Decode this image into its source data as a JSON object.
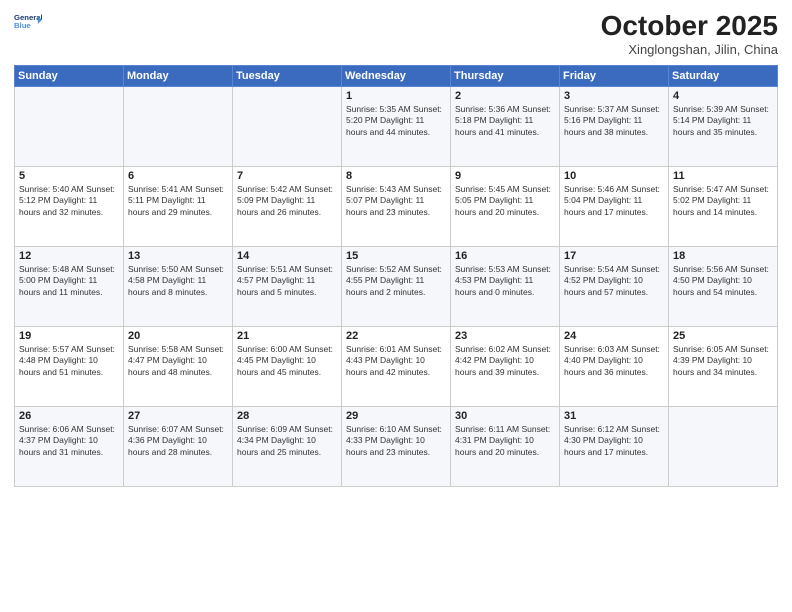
{
  "header": {
    "logo_line1": "General",
    "logo_line2": "Blue",
    "month": "October 2025",
    "location": "Xinglongshan, Jilin, China"
  },
  "weekdays": [
    "Sunday",
    "Monday",
    "Tuesday",
    "Wednesday",
    "Thursday",
    "Friday",
    "Saturday"
  ],
  "weeks": [
    [
      {
        "day": "",
        "info": ""
      },
      {
        "day": "",
        "info": ""
      },
      {
        "day": "",
        "info": ""
      },
      {
        "day": "1",
        "info": "Sunrise: 5:35 AM\nSunset: 5:20 PM\nDaylight: 11 hours\nand 44 minutes."
      },
      {
        "day": "2",
        "info": "Sunrise: 5:36 AM\nSunset: 5:18 PM\nDaylight: 11 hours\nand 41 minutes."
      },
      {
        "day": "3",
        "info": "Sunrise: 5:37 AM\nSunset: 5:16 PM\nDaylight: 11 hours\nand 38 minutes."
      },
      {
        "day": "4",
        "info": "Sunrise: 5:39 AM\nSunset: 5:14 PM\nDaylight: 11 hours\nand 35 minutes."
      }
    ],
    [
      {
        "day": "5",
        "info": "Sunrise: 5:40 AM\nSunset: 5:12 PM\nDaylight: 11 hours\nand 32 minutes."
      },
      {
        "day": "6",
        "info": "Sunrise: 5:41 AM\nSunset: 5:11 PM\nDaylight: 11 hours\nand 29 minutes."
      },
      {
        "day": "7",
        "info": "Sunrise: 5:42 AM\nSunset: 5:09 PM\nDaylight: 11 hours\nand 26 minutes."
      },
      {
        "day": "8",
        "info": "Sunrise: 5:43 AM\nSunset: 5:07 PM\nDaylight: 11 hours\nand 23 minutes."
      },
      {
        "day": "9",
        "info": "Sunrise: 5:45 AM\nSunset: 5:05 PM\nDaylight: 11 hours\nand 20 minutes."
      },
      {
        "day": "10",
        "info": "Sunrise: 5:46 AM\nSunset: 5:04 PM\nDaylight: 11 hours\nand 17 minutes."
      },
      {
        "day": "11",
        "info": "Sunrise: 5:47 AM\nSunset: 5:02 PM\nDaylight: 11 hours\nand 14 minutes."
      }
    ],
    [
      {
        "day": "12",
        "info": "Sunrise: 5:48 AM\nSunset: 5:00 PM\nDaylight: 11 hours\nand 11 minutes."
      },
      {
        "day": "13",
        "info": "Sunrise: 5:50 AM\nSunset: 4:58 PM\nDaylight: 11 hours\nand 8 minutes."
      },
      {
        "day": "14",
        "info": "Sunrise: 5:51 AM\nSunset: 4:57 PM\nDaylight: 11 hours\nand 5 minutes."
      },
      {
        "day": "15",
        "info": "Sunrise: 5:52 AM\nSunset: 4:55 PM\nDaylight: 11 hours\nand 2 minutes."
      },
      {
        "day": "16",
        "info": "Sunrise: 5:53 AM\nSunset: 4:53 PM\nDaylight: 11 hours\nand 0 minutes."
      },
      {
        "day": "17",
        "info": "Sunrise: 5:54 AM\nSunset: 4:52 PM\nDaylight: 10 hours\nand 57 minutes."
      },
      {
        "day": "18",
        "info": "Sunrise: 5:56 AM\nSunset: 4:50 PM\nDaylight: 10 hours\nand 54 minutes."
      }
    ],
    [
      {
        "day": "19",
        "info": "Sunrise: 5:57 AM\nSunset: 4:48 PM\nDaylight: 10 hours\nand 51 minutes."
      },
      {
        "day": "20",
        "info": "Sunrise: 5:58 AM\nSunset: 4:47 PM\nDaylight: 10 hours\nand 48 minutes."
      },
      {
        "day": "21",
        "info": "Sunrise: 6:00 AM\nSunset: 4:45 PM\nDaylight: 10 hours\nand 45 minutes."
      },
      {
        "day": "22",
        "info": "Sunrise: 6:01 AM\nSunset: 4:43 PM\nDaylight: 10 hours\nand 42 minutes."
      },
      {
        "day": "23",
        "info": "Sunrise: 6:02 AM\nSunset: 4:42 PM\nDaylight: 10 hours\nand 39 minutes."
      },
      {
        "day": "24",
        "info": "Sunrise: 6:03 AM\nSunset: 4:40 PM\nDaylight: 10 hours\nand 36 minutes."
      },
      {
        "day": "25",
        "info": "Sunrise: 6:05 AM\nSunset: 4:39 PM\nDaylight: 10 hours\nand 34 minutes."
      }
    ],
    [
      {
        "day": "26",
        "info": "Sunrise: 6:06 AM\nSunset: 4:37 PM\nDaylight: 10 hours\nand 31 minutes."
      },
      {
        "day": "27",
        "info": "Sunrise: 6:07 AM\nSunset: 4:36 PM\nDaylight: 10 hours\nand 28 minutes."
      },
      {
        "day": "28",
        "info": "Sunrise: 6:09 AM\nSunset: 4:34 PM\nDaylight: 10 hours\nand 25 minutes."
      },
      {
        "day": "29",
        "info": "Sunrise: 6:10 AM\nSunset: 4:33 PM\nDaylight: 10 hours\nand 23 minutes."
      },
      {
        "day": "30",
        "info": "Sunrise: 6:11 AM\nSunset: 4:31 PM\nDaylight: 10 hours\nand 20 minutes."
      },
      {
        "day": "31",
        "info": "Sunrise: 6:12 AM\nSunset: 4:30 PM\nDaylight: 10 hours\nand 17 minutes."
      },
      {
        "day": "",
        "info": ""
      }
    ]
  ]
}
